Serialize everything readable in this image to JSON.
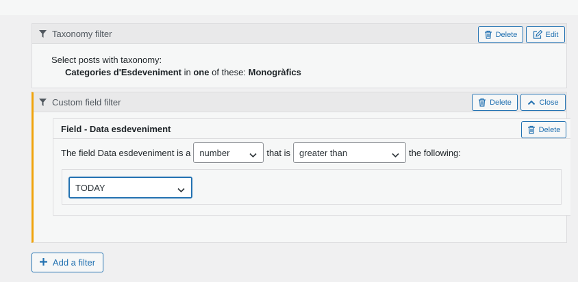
{
  "taxonomy_filter": {
    "title": "Taxonomy filter",
    "delete_label": "Delete",
    "edit_label": "Edit",
    "intro": "Select posts with taxonomy:",
    "taxonomy": "Categories d'Esdeveniment",
    "connector_in": "in",
    "quantifier": "one",
    "connector_of": "of these:",
    "terms": "Monogràfics"
  },
  "custom_field_filter": {
    "title": "Custom field filter",
    "delete_label": "Delete",
    "close_label": "Close",
    "field": {
      "title": "Field - Data esdeveniment",
      "delete_label": "Delete",
      "prefix": "The field Data esdeveniment is a",
      "type_value": "number",
      "middle": "that is",
      "operator_value": "greater than",
      "suffix": "the following:",
      "compare_value": "TODAY"
    }
  },
  "add_filter_label": "Add a filter",
  "icons": {
    "filter": "funnel-icon",
    "delete": "trash-icon",
    "edit": "edit-icon",
    "close": "chevron-up-icon",
    "select": "chevron-down-icon",
    "add": "plus-icon"
  },
  "colors": {
    "accent": "#2271b1",
    "active_border": "#f0a30a"
  }
}
